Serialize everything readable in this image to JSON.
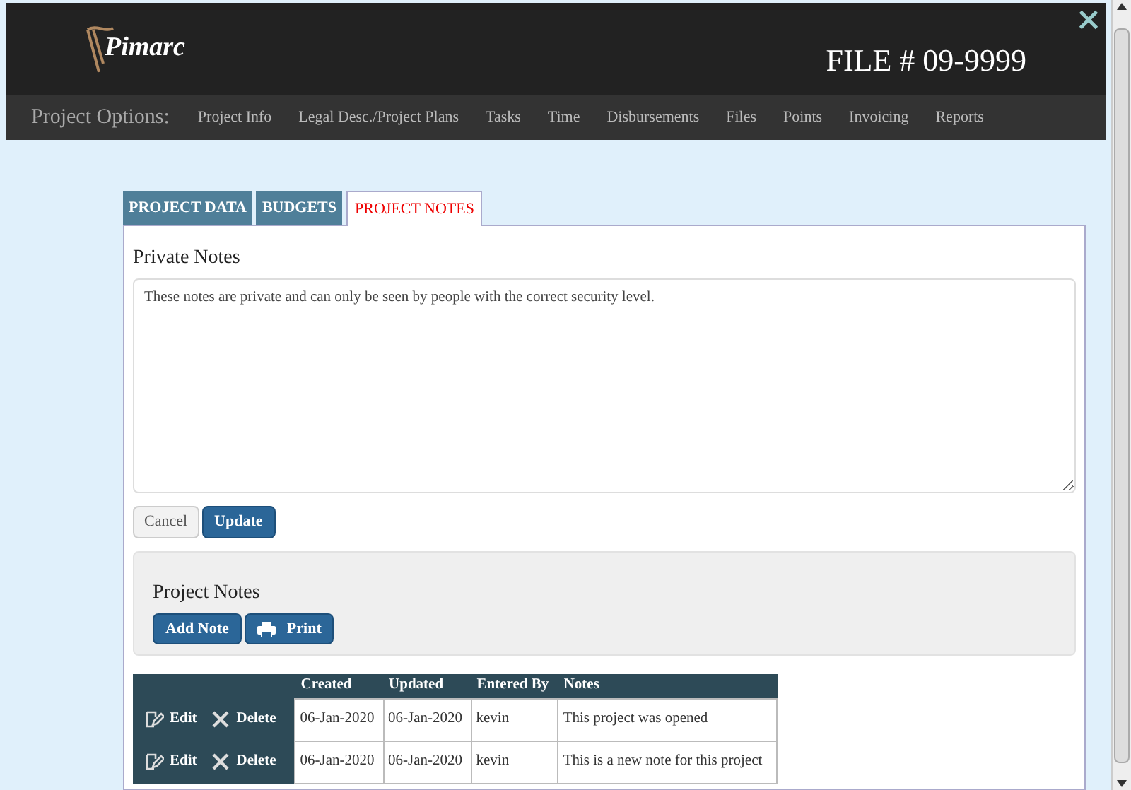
{
  "header": {
    "logo": "Pimarc",
    "file_number": "FILE # 09-9999"
  },
  "nav": {
    "label": "Project Options:",
    "items": [
      "Project Info",
      "Legal Desc./Project Plans",
      "Tasks",
      "Time",
      "Disbursements",
      "Files",
      "Points",
      "Invoicing",
      "Reports"
    ]
  },
  "tabs": [
    {
      "label": "PROJECT DATA",
      "selected": false
    },
    {
      "label": "BUDGETS",
      "selected": false
    },
    {
      "label": "PROJECT NOTES",
      "selected": true
    }
  ],
  "private_notes": {
    "title": "Private Notes",
    "value": "These notes are private and can only be seen by people with the correct security level.",
    "buttons": [
      "Cancel",
      "Update"
    ]
  },
  "project_notes": {
    "title": "Project Notes",
    "add_button": "Add Note",
    "print_button": "Print"
  },
  "table": {
    "columns": [
      "Created",
      "Updated",
      "Entered By",
      "Notes"
    ],
    "rows": [
      {
        "edit": "Edit",
        "delete": "Delete",
        "cells": [
          "06-Jan-2020",
          "06-Jan-2020",
          "kevin",
          "This project was opened"
        ]
      },
      {
        "edit": "Edit",
        "delete": "Delete",
        "cells": [
          "06-Jan-2020",
          "06-Jan-2020",
          "kevin",
          "This is a new note for this project"
        ]
      }
    ]
  }
}
